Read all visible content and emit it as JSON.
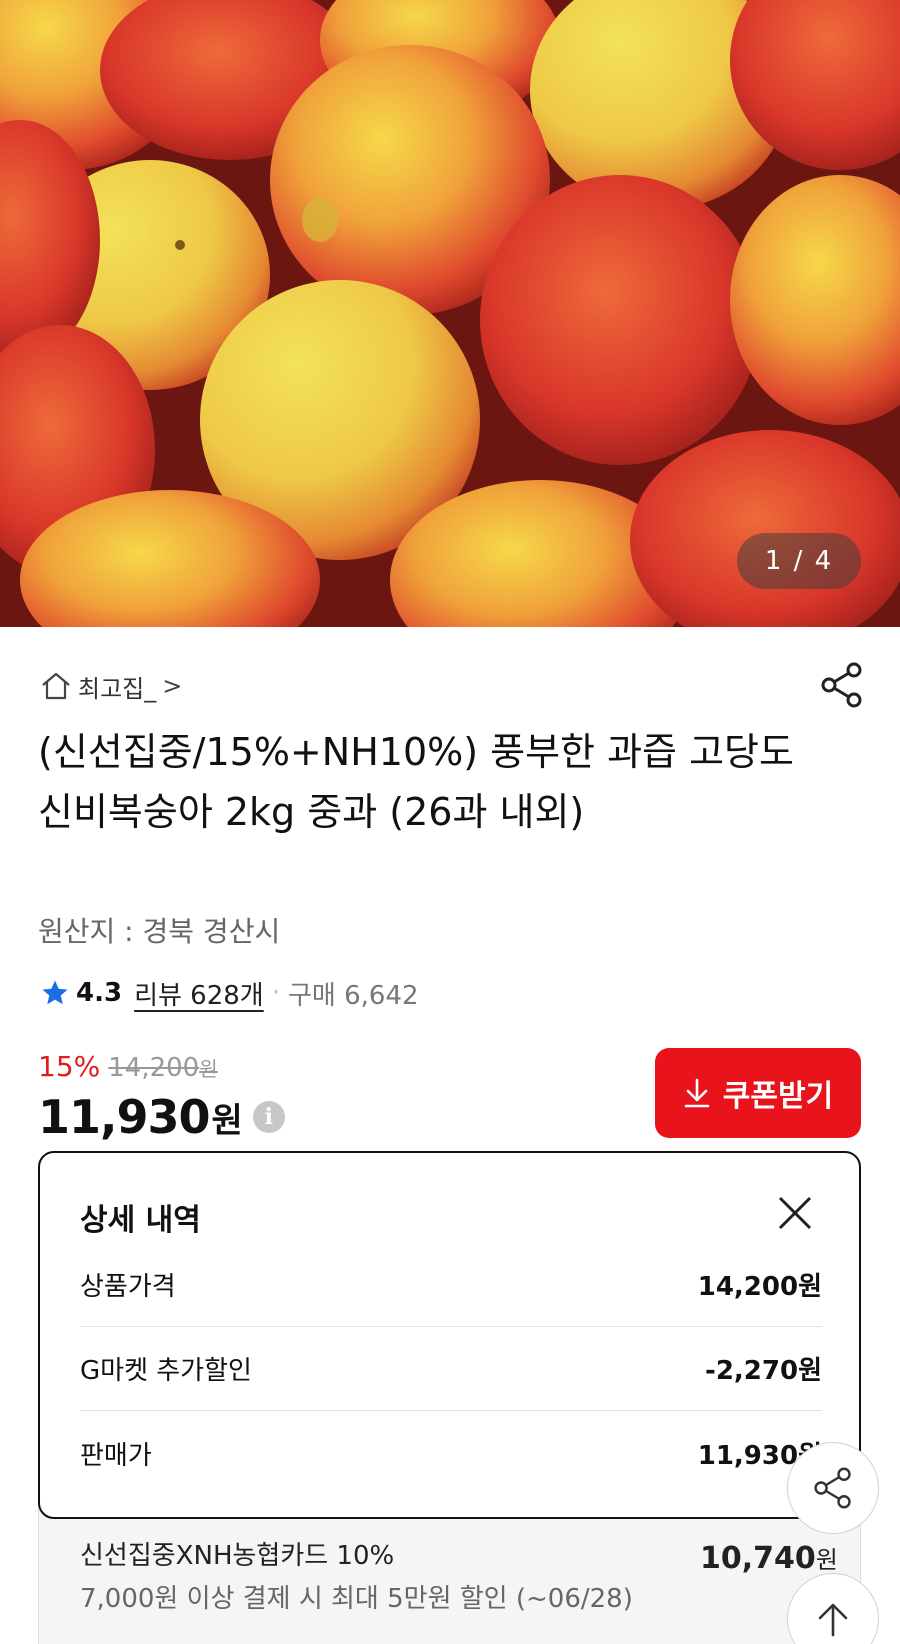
{
  "hero": {
    "pager": "1 / 4"
  },
  "store": {
    "name": "최고집_",
    "chevron": ">"
  },
  "product": {
    "title": "(신선집중/15%+NH10%) 풍부한 과즙 고당도 신비복숭아 2kg 중과 (26과 내외)",
    "origin": "원산지 : 경북 경산시"
  },
  "rating": {
    "score": "4.3",
    "review": "리뷰 628개",
    "dot": "·",
    "buy": "구매 6,642"
  },
  "price": {
    "discount": "15%",
    "original": "14,200",
    "original_unit": "원",
    "final": "11,930",
    "final_unit": "원",
    "info": "i"
  },
  "coupon": {
    "label": "쿠폰받기"
  },
  "detail": {
    "title": "상세 내역",
    "rows": [
      {
        "label": "상품가격",
        "value": "14,200원"
      },
      {
        "label": "G마켓 추가할인",
        "value": "-2,270원"
      },
      {
        "label": "판매가",
        "value": "11,930원"
      }
    ]
  },
  "card_offer": {
    "name": "신선집중XNH농협카드 10%",
    "desc": "7,000원 이상 결제 시 최대 5만원 할인 (~06/28)",
    "price": "10,740",
    "unit": "원"
  },
  "colors": {
    "accent": "#e8131b",
    "star": "#1a6fe8"
  }
}
